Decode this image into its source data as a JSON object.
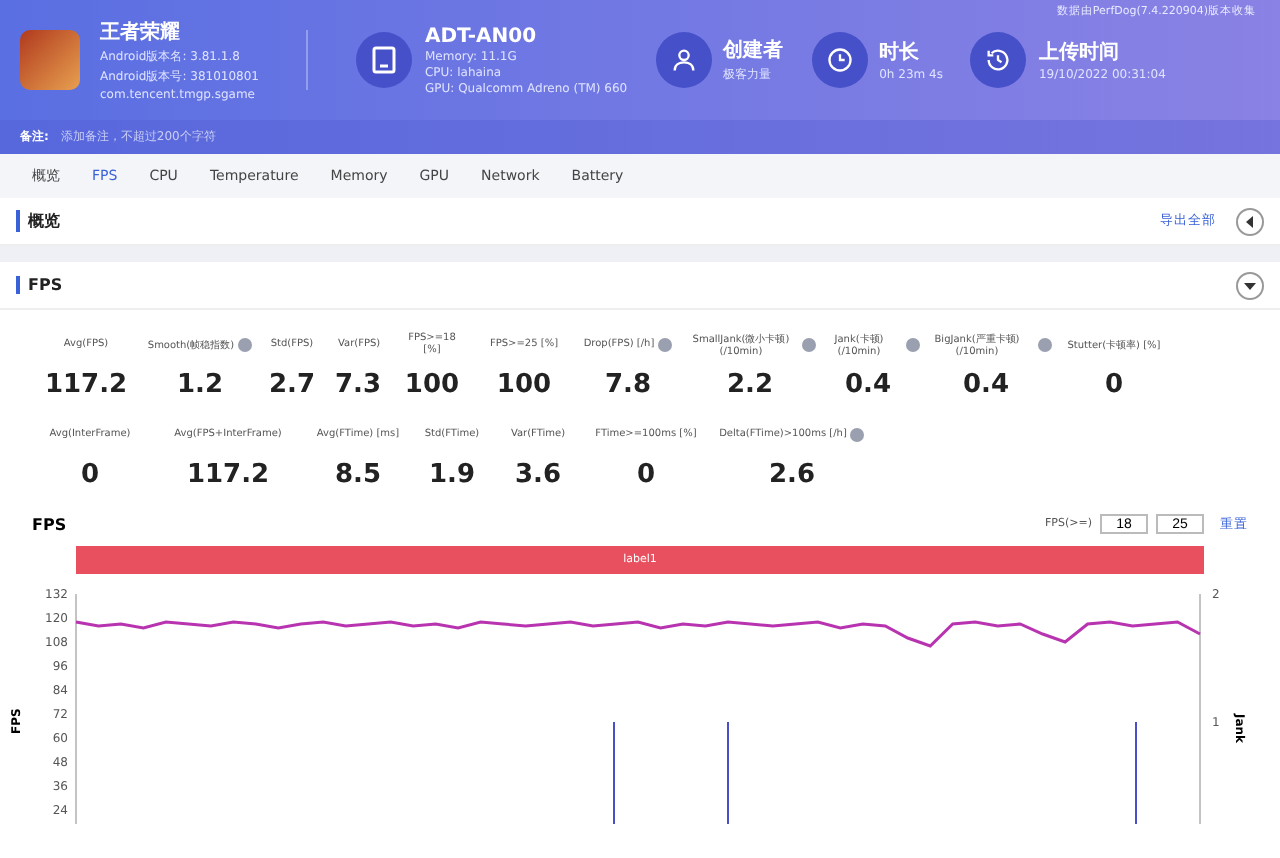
{
  "header": {
    "app": {
      "name": "王者荣耀",
      "version_name": "Android版本名: 3.81.1.8",
      "version_code": "Android版本号: 381010801",
      "package": "com.tencent.tmgp.sgame"
    },
    "device": {
      "name": "ADT-AN00",
      "memory": "Memory: 11.1G",
      "cpu": "CPU: lahaina",
      "gpu": "GPU: Qualcomm Adreno (TM) 660"
    },
    "info": [
      {
        "kind": "user",
        "title": "创建者",
        "value": "极客力量"
      },
      {
        "kind": "clock",
        "title": "时长",
        "value": "0h 23m 4s"
      },
      {
        "kind": "history",
        "title": "上传时间",
        "value": "19/10/2022 00:31:04"
      }
    ],
    "source_note": "数据由PerfDog(7.4.220904)版本收集",
    "remark": {
      "label": "备注:",
      "placeholder": "添加备注，不超过200个字符"
    }
  },
  "tabs": [
    {
      "label": "概览",
      "selected": false
    },
    {
      "label": "FPS",
      "selected": true
    },
    {
      "label": "CPU",
      "selected": false
    },
    {
      "label": "Temperature",
      "selected": false
    },
    {
      "label": "Memory",
      "selected": false
    },
    {
      "label": "GPU",
      "selected": false
    },
    {
      "label": "Network",
      "selected": false
    },
    {
      "label": "Battery",
      "selected": false
    }
  ],
  "overview": {
    "title": "概览",
    "export": "导出全部",
    "expanded": false
  },
  "fps_section": {
    "title": "FPS",
    "expanded": true,
    "metric_rows": [
      [
        {
          "label": "Avg(FPS)",
          "value": "117.2",
          "help": false
        },
        {
          "label": "Smooth(帧稳指数)",
          "value": "1.2",
          "help": true
        },
        {
          "label": "Std(FPS)",
          "value": "2.7",
          "help": false
        },
        {
          "label": "Var(FPS)",
          "value": "7.3",
          "help": false
        },
        {
          "label": "FPS>=18 [%]",
          "value": "100",
          "help": false
        },
        {
          "label": "FPS>=25 [%]",
          "value": "100",
          "help": false
        },
        {
          "label": "Drop(FPS) [/h]",
          "value": "7.8",
          "help": true
        },
        {
          "label": "SmallJank(微小卡顿) (/10min)",
          "value": "2.2",
          "help": true
        },
        {
          "label": "Jank(卡顿) (/10min)",
          "value": "0.4",
          "help": true
        },
        {
          "label": "BigJank(严重卡顿) (/10min)",
          "value": "0.4",
          "help": true
        },
        {
          "label": "Stutter(卡顿率) [%]",
          "value": "0",
          "help": false
        }
      ],
      [
        {
          "label": "Avg(InterFrame)",
          "value": "0",
          "help": false
        },
        {
          "label": "Avg(FPS+InterFrame)",
          "value": "117.2",
          "help": false
        },
        {
          "label": "Avg(FTime) [ms]",
          "value": "8.5",
          "help": false
        },
        {
          "label": "Std(FTime)",
          "value": "1.9",
          "help": false
        },
        {
          "label": "Var(FTime)",
          "value": "3.6",
          "help": false
        },
        {
          "label": "FTime>=100ms [%]",
          "value": "0",
          "help": false
        },
        {
          "label": "Delta(FTime)>100ms [/h]",
          "value": "2.6",
          "help": true
        }
      ]
    ],
    "chart": {
      "title": "FPS",
      "threshold_label": "FPS(>=)",
      "thresholds": [
        "18",
        "25"
      ],
      "reset": "重置",
      "label_bar": "label1",
      "chart_data": {
        "type": "line",
        "ylim": [
          24,
          132
        ],
        "yticks": [
          24,
          36,
          48,
          60,
          72,
          84,
          96,
          108,
          120,
          132
        ],
        "series": [
          {
            "name": "FPS",
            "color": "#b833b0",
            "values": [
              118,
              116,
              117,
              115,
              118,
              117,
              116,
              118,
              117,
              115,
              117,
              118,
              116,
              117,
              118,
              116,
              117,
              115,
              118,
              117,
              116,
              117,
              118,
              116,
              117,
              118,
              115,
              117,
              116,
              118,
              117,
              116,
              117,
              118,
              115,
              117,
              116,
              110,
              106,
              117,
              118,
              116,
              117,
              112,
              108,
              117,
              118,
              116,
              117,
              118,
              112
            ]
          }
        ]
      },
      "jank_axis": {
        "label": "Jank",
        "ticks": [
          "2",
          "1"
        ]
      }
    }
  }
}
